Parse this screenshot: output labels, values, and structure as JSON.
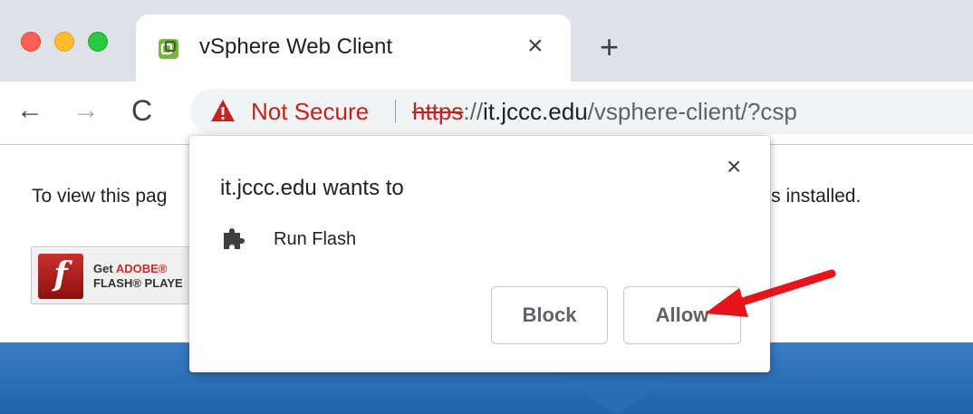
{
  "browser": {
    "tab": {
      "title": "vSphere Web Client",
      "close_glyph": "×",
      "favicon": "vsphere-icon"
    },
    "new_tab_glyph": "+",
    "nav": {
      "back_glyph": "←",
      "forward_glyph": "→",
      "reload_glyph": "C"
    },
    "omnibox": {
      "security_label": "Not Secure",
      "url_scheme": "https",
      "url_sep": "://",
      "url_host": "it.jccc.edu",
      "url_path": "/vsphere-client/?csp"
    }
  },
  "page": {
    "message_start": "To view this pag",
    "message_end": "ater is installed.",
    "flash_badge": {
      "get": "Get ",
      "adobe": "ADOBE®",
      "player": "FLASH® PLAYE",
      "logo_glyph": "f"
    }
  },
  "popup": {
    "title": "it.jccc.edu wants to",
    "close_glyph": "×",
    "permission": {
      "label": "Run Flash",
      "icon": "puzzle-icon"
    },
    "block_label": "Block",
    "allow_label": "Allow"
  },
  "colors": {
    "warning": "#c5221f",
    "band": "#2b6fb8",
    "arrow": "#e8141b"
  }
}
